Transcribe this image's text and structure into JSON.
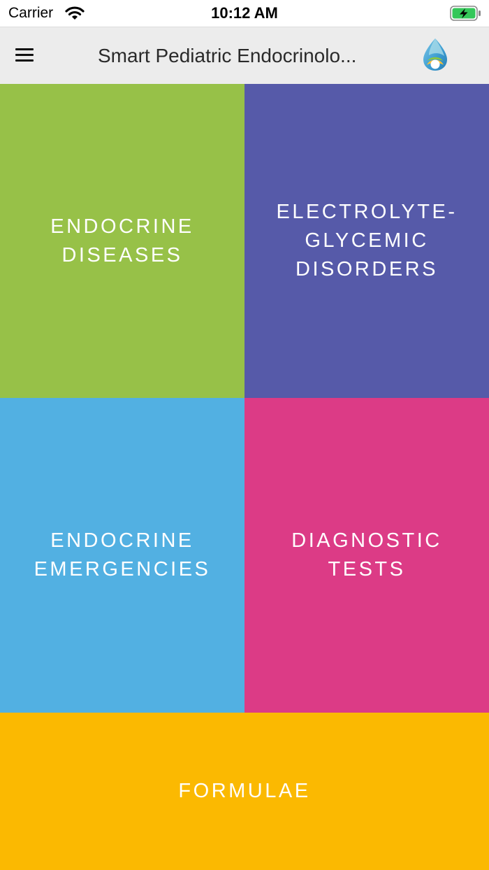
{
  "status_bar": {
    "carrier": "Carrier",
    "time": "10:12 AM",
    "wifi_icon": "wifi-icon",
    "battery_icon": "battery-charging-icon",
    "battery_color": "#34c759"
  },
  "nav_bar": {
    "title": "Smart Pediatric Endocrinolo...",
    "menu_icon": "hamburger-menu-icon",
    "logo_icon": "droplet-logo-icon",
    "background": "#ececec"
  },
  "tiles": [
    {
      "label": "ENDOCRINE\nDISEASES",
      "color": "#97c148"
    },
    {
      "label": "ELECTROLYTE-\nGLYCEMIC\nDISORDERS",
      "color": "#565aa9"
    },
    {
      "label": "ENDOCRINE\nEMERGENCIES",
      "color": "#52b0e2"
    },
    {
      "label": "DIAGNOSTIC\nTESTS",
      "color": "#dc3b86"
    },
    {
      "label": "FORMULAE",
      "color": "#fbb901"
    }
  ]
}
